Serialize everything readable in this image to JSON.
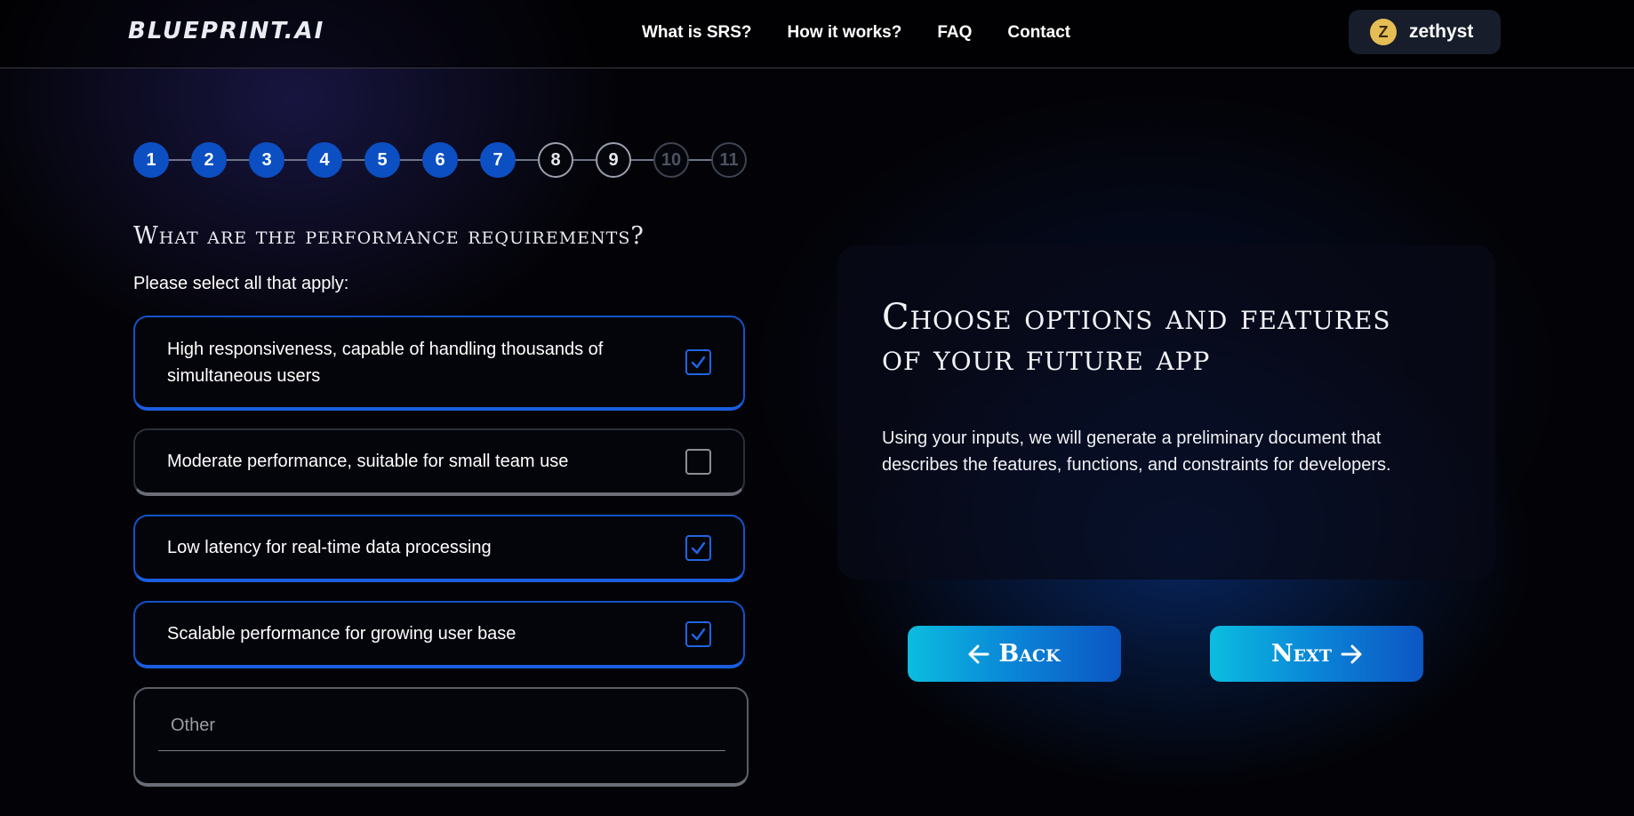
{
  "header": {
    "logo": "BLUEPRINT.AI",
    "nav": [
      "What is SRS?",
      "How it works?",
      "FAQ",
      "Contact"
    ],
    "user": {
      "initial": "Z",
      "name": "zethyst"
    }
  },
  "stepper": {
    "steps": [
      "1",
      "2",
      "3",
      "4",
      "5",
      "6",
      "7",
      "8",
      "9",
      "10",
      "11"
    ],
    "completed_through": 7,
    "current": [
      8,
      9
    ]
  },
  "question": {
    "title": "What are the performance requirements?",
    "hint": "Please select all that apply:",
    "options": [
      {
        "label": "High responsiveness, capable of handling thousands of simultaneous users",
        "checked": true
      },
      {
        "label": "Moderate performance, suitable for small team use",
        "checked": false
      },
      {
        "label": "Low latency for real-time data processing",
        "checked": true
      },
      {
        "label": "Scalable performance for growing user base",
        "checked": true
      }
    ],
    "other_placeholder": "Other"
  },
  "info": {
    "title": "Choose options and features of your future app",
    "text": "Using your inputs, we will generate a preliminary document that describes the features, functions, and constraints for developers."
  },
  "buttons": {
    "back": "Back",
    "next": "Next"
  },
  "colors": {
    "accent": "#0c4fc3",
    "button_start": "#0bbde0",
    "button_end": "#0c56c4",
    "avatar": "#e6bd55"
  }
}
